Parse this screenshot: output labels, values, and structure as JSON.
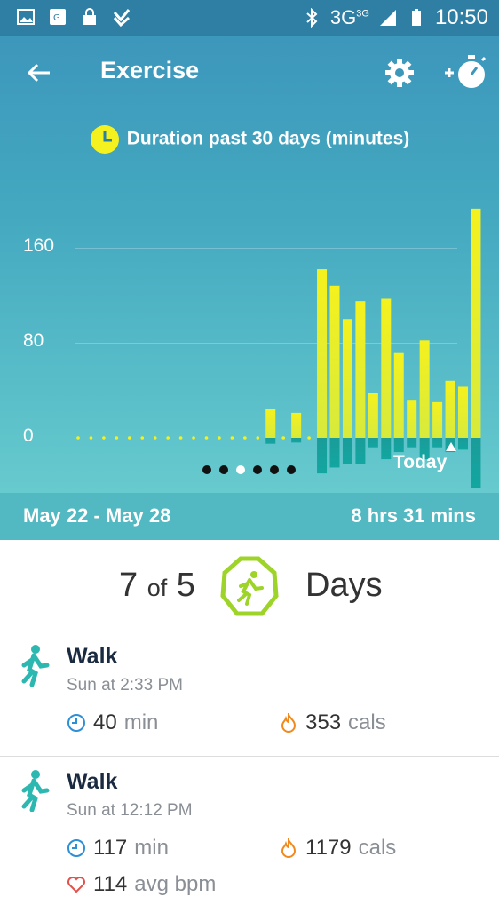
{
  "status_bar": {
    "network": "3G",
    "network_sup": "3G",
    "time": "10:50"
  },
  "app_bar": {
    "title": "Exercise"
  },
  "chart_title": "Duration past 30 days (minutes)",
  "chart_data": {
    "type": "bar",
    "title": "Duration past 30 days (minutes)",
    "y_ticks": [
      "160",
      "80",
      "0"
    ],
    "ylim": [
      0,
      200
    ],
    "x_label_last": "Today",
    "grid": true,
    "values_up": [
      0,
      0,
      0,
      0,
      0,
      0,
      0,
      0,
      0,
      0,
      0,
      0,
      0,
      0,
      0,
      24,
      0,
      21,
      0,
      142,
      128,
      100,
      115,
      38,
      117,
      72,
      32,
      82,
      30,
      48,
      43,
      193
    ],
    "values_down": [
      0,
      0,
      0,
      0,
      0,
      0,
      0,
      0,
      0,
      0,
      0,
      0,
      0,
      0,
      0,
      5,
      0,
      4,
      0,
      30,
      25,
      22,
      22,
      8,
      18,
      12,
      8,
      18,
      8,
      12,
      10,
      42
    ]
  },
  "pager": {
    "count": 6,
    "active": 2
  },
  "range": {
    "dates": "May 22 - May 28",
    "total": "8 hrs 31 mins"
  },
  "goal": {
    "count": "7",
    "of": "of",
    "target": "5",
    "label": "Days"
  },
  "entries": [
    {
      "name": "Walk",
      "time": "Sun at 2:33 PM",
      "duration": "40",
      "duration_unit": "min",
      "cals": "353",
      "cals_unit": "cals"
    },
    {
      "name": "Walk",
      "time": "Sun at 12:12 PM",
      "duration": "117",
      "duration_unit": "min",
      "cals": "1179",
      "cals_unit": "cals",
      "hr": "114",
      "hr_unit": "avg bpm"
    }
  ],
  "colors": {
    "bar_up": "#f5f11e",
    "bar_down": "#13a6a1",
    "accent": "#9ed42a"
  }
}
